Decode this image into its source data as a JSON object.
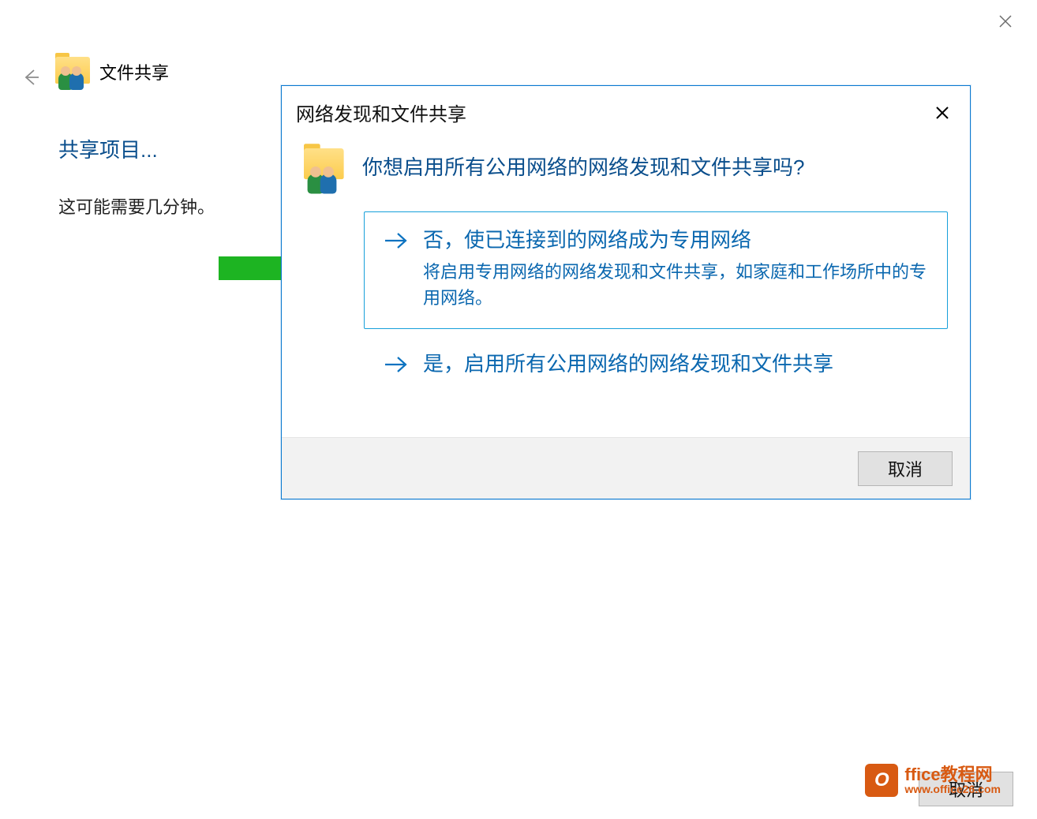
{
  "outer": {
    "title": "文件共享",
    "heading": "共享项目...",
    "subtext": "这可能需要几分钟。",
    "cancel_label": "取消"
  },
  "dialog": {
    "title": "网络发现和文件共享",
    "question": "你想启用所有公用网络的网络发现和文件共享吗?",
    "options": [
      {
        "title": "否，使已连接到的网络成为专用网络",
        "desc": "将启用专用网络的网络发现和文件共享，如家庭和工作场所中的专用网络。",
        "highlight": true
      },
      {
        "title": "是，启用所有公用网络的网络发现和文件共享"
      }
    ],
    "cancel_label": "取消"
  },
  "watermark": {
    "brand": "ffice教程网",
    "url": "www.office26.com",
    "badge": "O"
  }
}
